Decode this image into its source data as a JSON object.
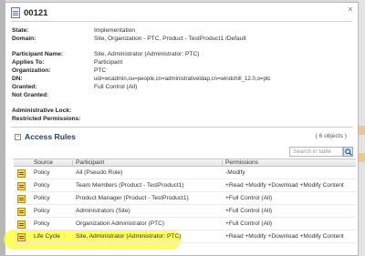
{
  "window": {
    "title": "00121"
  },
  "properties": [
    {
      "label": "State:",
      "value": "Implementation"
    },
    {
      "label": "Domain:",
      "value": "Site, Organization - PTC, Product - TestProduct1 /Default"
    },
    {
      "label": "Participant Name:",
      "value": "Site, Administrator (Administrator: PTC)"
    },
    {
      "label": "Applies To:",
      "value": "Participant"
    },
    {
      "label": "Organization:",
      "value": "PTC"
    },
    {
      "label": "DN:",
      "value": "uid=wcadmin,ou=people,cn=administrativeldap,cn=windchill_12.0,o=ptc"
    },
    {
      "label": "Granted:",
      "value": "Full Control (All)"
    },
    {
      "label": "Not Granted:",
      "value": ""
    },
    {
      "label": "Administrative Lock:",
      "value": ""
    },
    {
      "label": "Restricted Permissions:",
      "value": ""
    }
  ],
  "access_rules": {
    "title": "Access Rules",
    "count": "( 6 objects )",
    "search_placeholder": "Search in table",
    "columns": {
      "source": "Source",
      "participant": "Participant",
      "permissions": "Permissions"
    },
    "rows": [
      {
        "source": "Policy",
        "participant": "All (Pseudo Role)",
        "permissions": "-Modify",
        "icon": "policy-icon"
      },
      {
        "source": "Policy",
        "participant": "Team Members (Product - TestProduct1)",
        "permissions": "+Read +Modify +Download +Modify Content",
        "icon": "policy-icon"
      },
      {
        "source": "Policy",
        "participant": "Product Manager (Product - TestProduct1)",
        "permissions": "+Full Control (All)",
        "icon": "policy-icon"
      },
      {
        "source": "Policy",
        "participant": "Administrators (Site)",
        "permissions": "+Full Control (All)",
        "icon": "policy-icon"
      },
      {
        "source": "Policy",
        "participant": "Organization Administrator (PTC)",
        "permissions": "+Full Control (All)",
        "icon": "policy-icon"
      },
      {
        "source": "Life Cycle",
        "participant": "Site, Administrator (Administrator: PTC)",
        "permissions": "+Read +Modify +Download +Modify Content",
        "icon": "lifecycle-icon"
      }
    ]
  },
  "colors": {
    "highlight": "#ffff28",
    "section_title": "#1f3d5c",
    "link": "#1a4f8b"
  }
}
